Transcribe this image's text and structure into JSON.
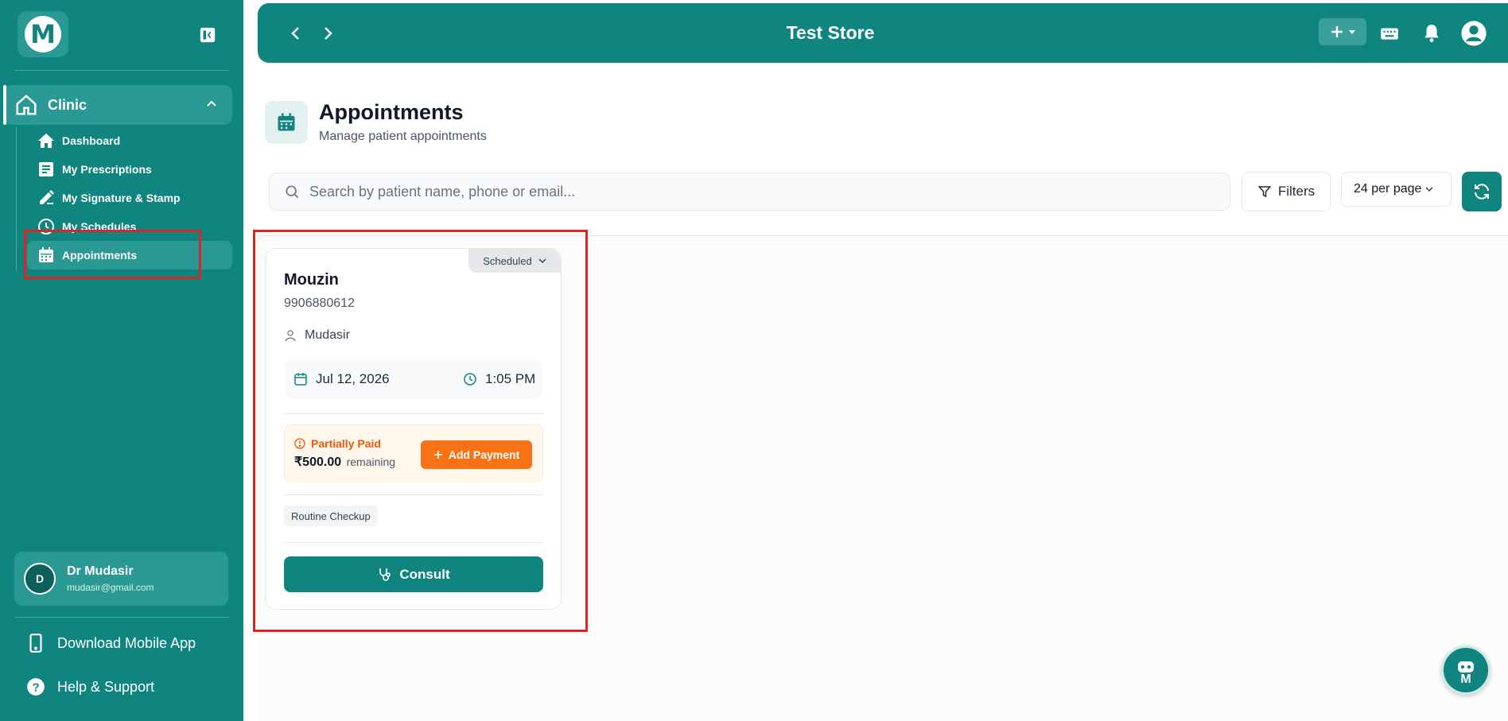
{
  "brand": {
    "logo_letter": "M",
    "accent": "#10847e",
    "accent_light": "#2a9993"
  },
  "sidebar": {
    "section": {
      "label": "Clinic",
      "icon": "home-icon",
      "expanded": true
    },
    "items": [
      {
        "label": "Dashboard",
        "icon": "home-icon",
        "active": false
      },
      {
        "label": "My Prescriptions",
        "icon": "document-icon",
        "active": false
      },
      {
        "label": "My Signature & Stamp",
        "icon": "pen-icon",
        "active": false
      },
      {
        "label": "My Schedules",
        "icon": "clock-icon",
        "active": false
      },
      {
        "label": "Appointments",
        "icon": "calendar-icon",
        "active": true
      }
    ],
    "user": {
      "initial": "D",
      "name": "Dr Mudasir",
      "email": "mudasir@gmail.com"
    },
    "download_app": "Download Mobile App",
    "help": "Help & Support"
  },
  "topbar": {
    "title": "Test Store"
  },
  "page": {
    "title": "Appointments",
    "subtitle": "Manage patient appointments"
  },
  "toolbar": {
    "search_placeholder": "Search by patient name, phone or email...",
    "filters_label": "Filters",
    "per_page": "24 per page"
  },
  "appointments": [
    {
      "status": "Scheduled",
      "patient_name": "Mouzin",
      "phone": "9906880612",
      "doctor": "Mudasir",
      "date": "Jul 12, 2026",
      "time": "1:05 PM",
      "payment_status": "Partially Paid",
      "amount": "₹500.00",
      "amount_note": "remaining",
      "add_payment_label": "Add Payment",
      "tag": "Routine Checkup",
      "consult_label": "Consult"
    }
  ],
  "colors": {
    "payment_warning": "#ea580c",
    "add_payment": "#f97316",
    "highlight": "#e02424"
  }
}
